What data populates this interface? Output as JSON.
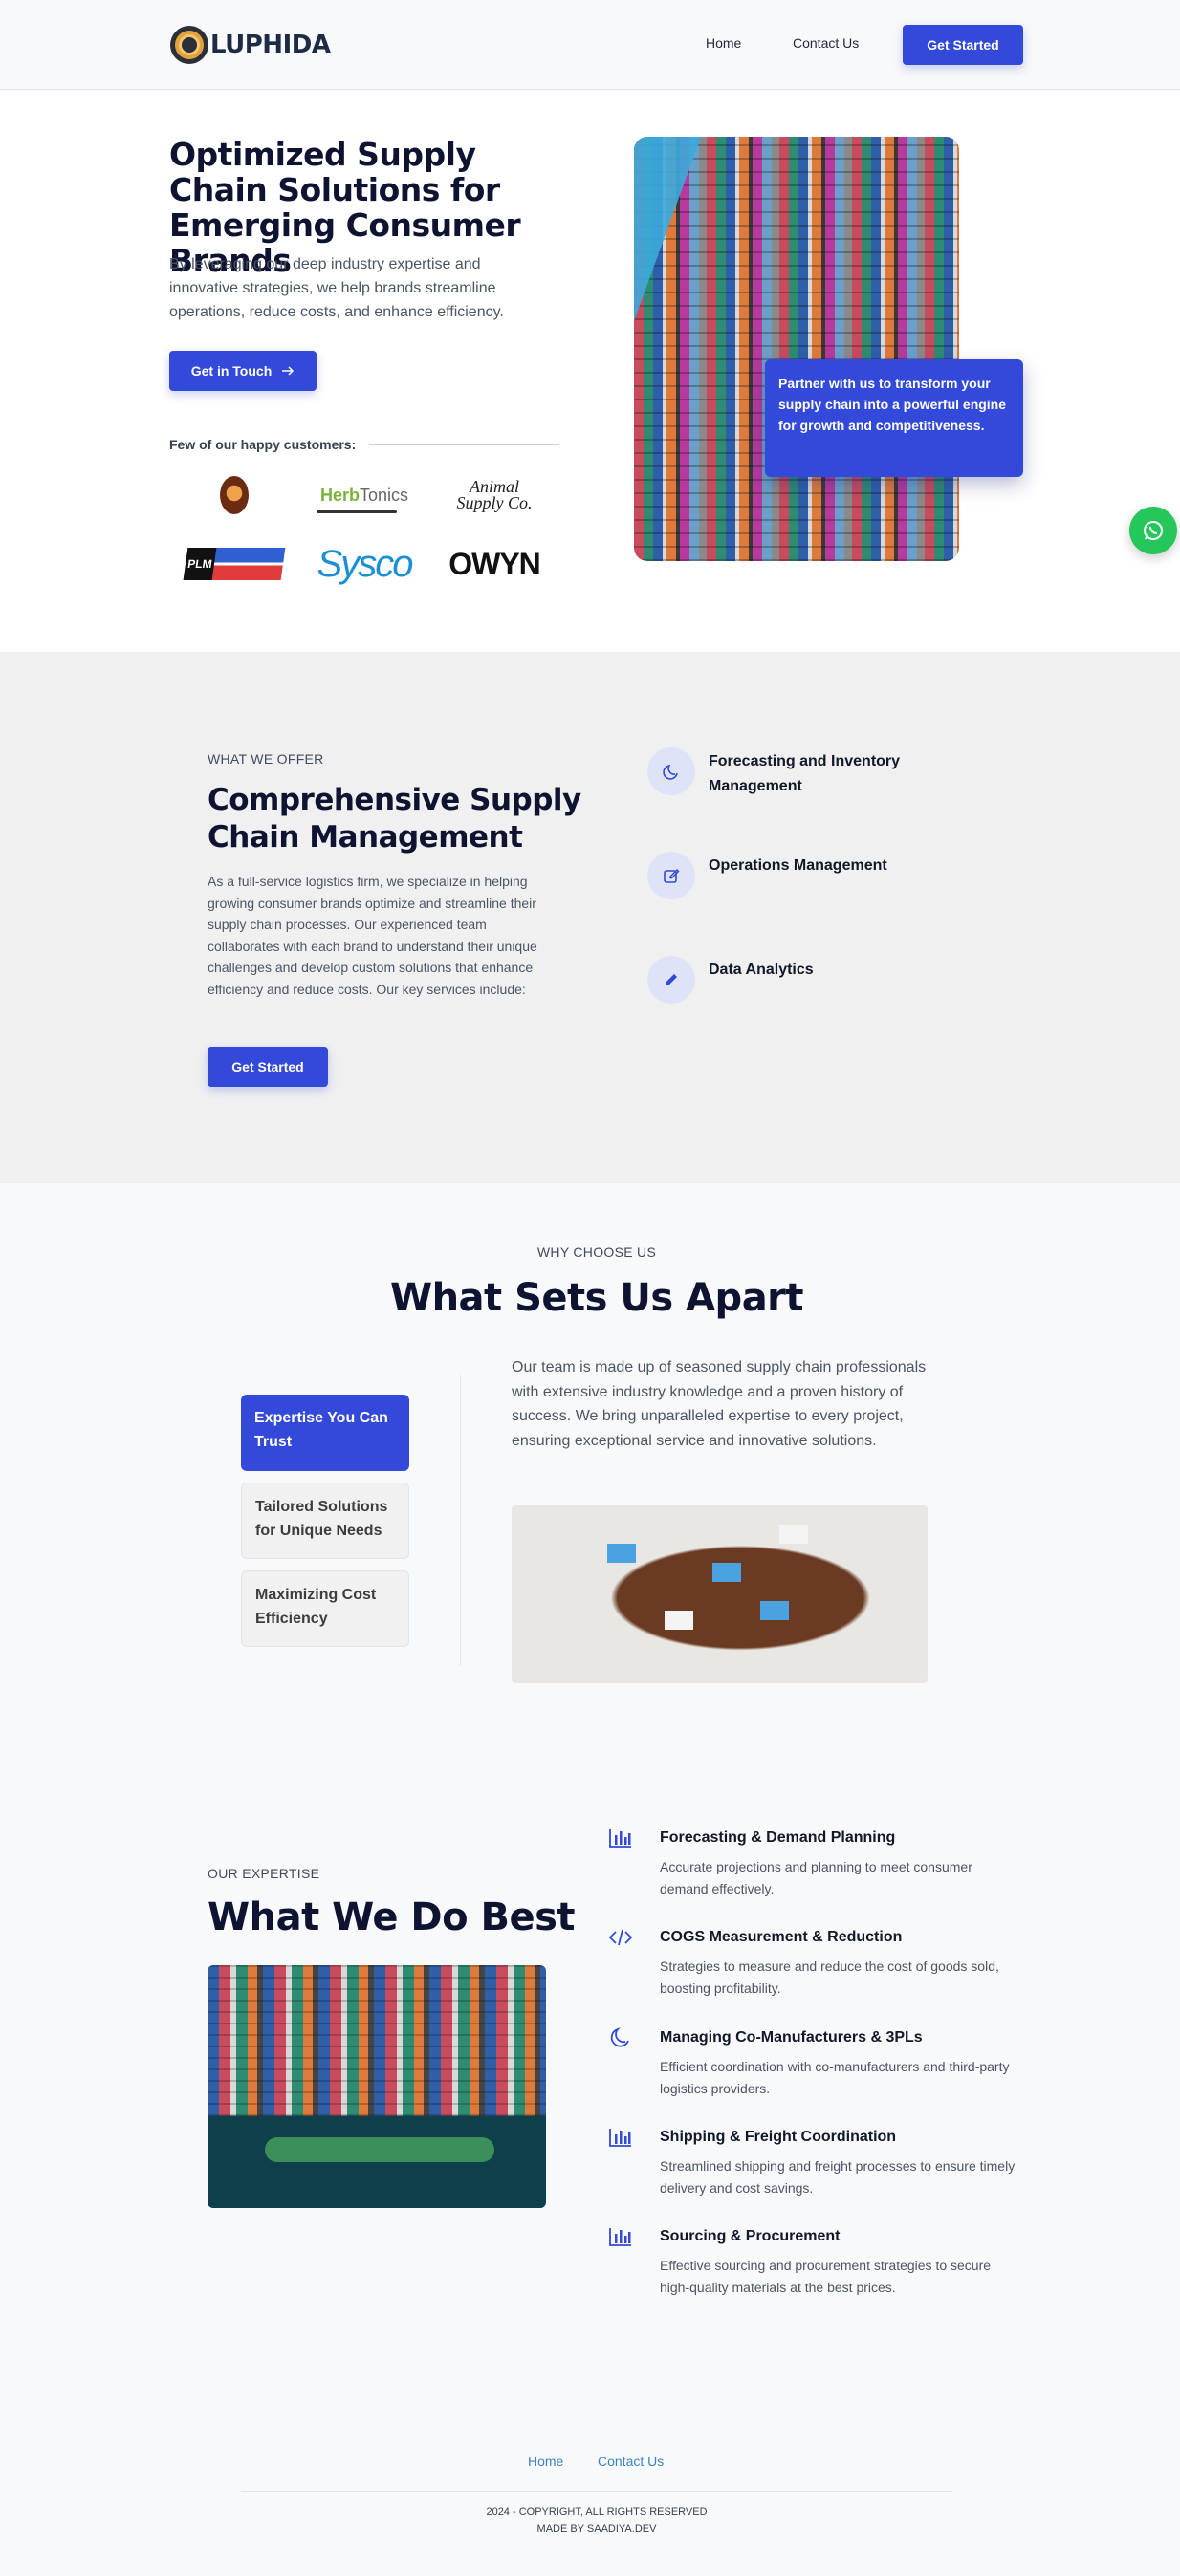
{
  "nav": {
    "logo_text": "LUPHIDA",
    "links": [
      "Home",
      "Contact Us"
    ],
    "cta": "Get Started"
  },
  "hero": {
    "title": "Optimized Supply Chain Solutions for Emerging Consumer Brands",
    "subtitle": "By leveraging our deep industry expertise and innovative strategies, we help brands streamline operations, reduce costs, and enhance efficiency.",
    "cta": "Get in Touch",
    "customers_label": "Few of our happy customers:",
    "customer_logos": {
      "herb_a": "Herb",
      "herb_b": "Tonics",
      "animal_line1": "Animal",
      "animal_line2": "Supply Co.",
      "sysco": "Sysco",
      "owyn": "OWYN"
    },
    "card_text": "Partner with us to transform your supply chain into a powerful engine for growth and competitiveness."
  },
  "offer": {
    "eyebrow": "WHAT WE OFFER",
    "title": "Comprehensive Supply Chain Management",
    "body": "As a full-service logistics firm, we specialize in helping growing consumer brands optimize and streamline their supply chain processes. Our experienced team collaborates with each brand to understand their unique challenges and develop custom solutions that enhance efficiency and reduce costs. Our key services include:",
    "cta": "Get Started",
    "services": [
      {
        "label": "Forecasting and Inventory Management",
        "icon": "moon-icon"
      },
      {
        "label": "Operations Management",
        "icon": "edit-icon"
      },
      {
        "label": "Data Analytics",
        "icon": "pencil-icon"
      }
    ]
  },
  "why": {
    "eyebrow": "WHY CHOOSE US",
    "title": "What Sets Us Apart",
    "tabs": [
      "Expertise You Can Trust",
      "Tailored Solutions for Unique Needs",
      "Maximizing Cost Efficiency"
    ],
    "active_tab": 0,
    "text": "Our team is made up of seasoned supply chain professionals with extensive industry knowledge and a proven history of success. We bring unparalleled expertise to every project, ensuring exceptional service and innovative solutions."
  },
  "best": {
    "eyebrow": "OUR EXPERTISE",
    "title": "What We Do Best",
    "items": [
      {
        "title": "Forecasting & Demand Planning",
        "desc": "Accurate projections and planning to meet consumer demand effectively.",
        "icon": "bar-chart-icon"
      },
      {
        "title": "COGS Measurement & Reduction",
        "desc": "Strategies to measure and reduce the cost of goods sold, boosting profitability.",
        "icon": "code-icon"
      },
      {
        "title": "Managing Co-Manufacturers & 3PLs",
        "desc": "Efficient coordination with co-manufacturers and third-party logistics providers.",
        "icon": "moon-icon"
      },
      {
        "title": "Shipping & Freight Coordination",
        "desc": "Streamlined shipping and freight processes to ensure timely delivery and cost savings.",
        "icon": "bar-chart-icon"
      },
      {
        "title": "Sourcing & Procurement",
        "desc": "Effective sourcing and procurement strategies to secure high-quality materials at the best prices.",
        "icon": "bar-chart-icon"
      }
    ]
  },
  "footer": {
    "links": [
      "Home",
      "Contact Us"
    ],
    "copyright": "2024 - COPYRIGHT, ALL RIGHTS RESERVED",
    "made_by": "MADE BY SAADIYA.DEV"
  },
  "colors": {
    "primary": "#3249d9",
    "whatsapp": "#25c65a",
    "offer_bg": "#f0f0f1",
    "icon_bg": "#dfe3f8"
  }
}
